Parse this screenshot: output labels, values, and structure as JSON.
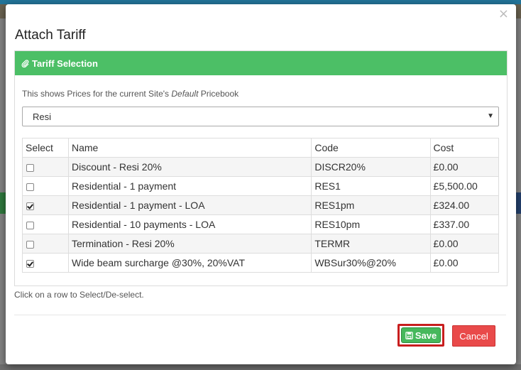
{
  "modal": {
    "title": "Attach Tariff",
    "close_glyph": "×"
  },
  "panel": {
    "heading": "Tariff Selection",
    "info_prefix": "This shows Prices for the current Site's",
    "info_emphasis": "Default",
    "info_suffix": "Pricebook"
  },
  "pricebook_select": {
    "value": "Resi"
  },
  "table": {
    "headers": [
      "Select",
      "Name",
      "Code",
      "Cost"
    ],
    "rows": [
      {
        "selected": false,
        "name": "Discount - Resi 20%",
        "code": "DISCR20%",
        "cost": "£0.00"
      },
      {
        "selected": false,
        "name": "Residential - 1 payment",
        "code": "RES1",
        "cost": "£5,500.00"
      },
      {
        "selected": true,
        "name": "Residential - 1 payment - LOA",
        "code": "RES1pm",
        "cost": "£324.00"
      },
      {
        "selected": false,
        "name": "Residential - 10 payments - LOA",
        "code": "RES10pm",
        "cost": "£337.00"
      },
      {
        "selected": false,
        "name": "Termination - Resi 20%",
        "code": "TERMR",
        "cost": "£0.00"
      },
      {
        "selected": true,
        "name": "Wide beam surcharge @30%, 20%VAT",
        "code": "WBSur30%@20%",
        "cost": "£0.00"
      }
    ]
  },
  "hint": "Click on a row to Select/De-select.",
  "buttons": {
    "save": "Save",
    "cancel": "Cancel"
  },
  "colors": {
    "panel_heading": "#4cbf66",
    "save": "#46b85c",
    "cancel": "#e94a4a",
    "highlight_border": "#c81e1e"
  }
}
